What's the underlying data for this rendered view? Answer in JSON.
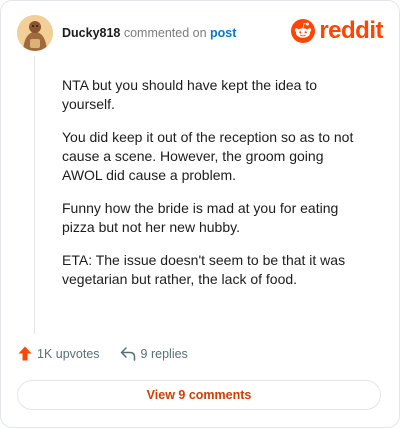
{
  "comment": {
    "username": "Ducky818",
    "action_text": "commented on",
    "post_link": "post",
    "paragraphs": [
      "NTA but you should have kept the idea to yourself.",
      "You did keep it out of the reception so as to not cause a scene. However, the groom going AWOL did cause a problem.",
      "Funny how the bride is mad at you for eating pizza but not her new hubby.",
      "ETA: The issue doesn't seem to be that it was vegetarian but rather, the lack of food."
    ]
  },
  "brand": {
    "logo_text": "reddit",
    "color": "#ff4500"
  },
  "actions": {
    "upvotes_label": "1K upvotes",
    "replies_label": "9 replies",
    "view_comments_label": "View 9 comments"
  },
  "icons": {
    "avatar": "duck-avatar-icon",
    "logo": "reddit-snoo-icon",
    "upvote": "upvote-arrow-icon",
    "reply": "reply-arrow-icon"
  }
}
